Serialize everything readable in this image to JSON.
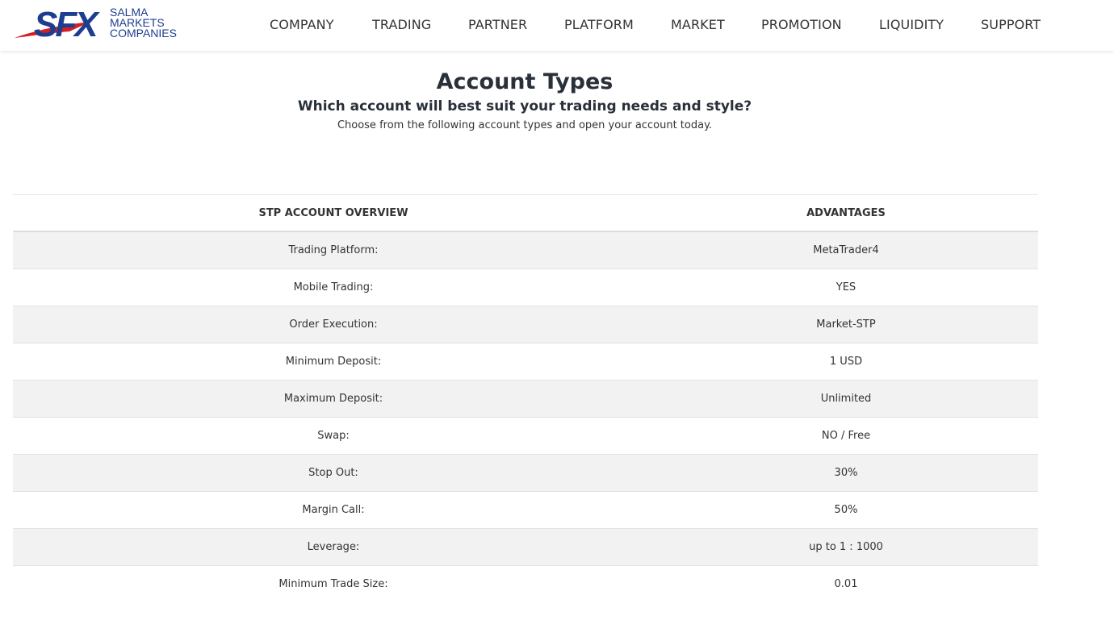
{
  "brand": {
    "mark": "SFX",
    "name_lines": [
      "SALMA",
      "MARKETS",
      "COMPANIES"
    ],
    "colors": {
      "blue": "#1d3d8f",
      "red": "#d21f26"
    }
  },
  "nav": {
    "items": [
      "COMPANY",
      "TRADING",
      "PARTNER",
      "PLATFORM",
      "MARKET",
      "PROMOTION",
      "LIQUIDITY",
      "SUPPORT"
    ]
  },
  "hero": {
    "title": "Account Types",
    "subtitle": "Which account will best suit your trading needs and style?",
    "lead": "Choose from the following account types and open your account today."
  },
  "table": {
    "headers": [
      "STP ACCOUNT OVERVIEW",
      "ADVANTAGES"
    ],
    "rows": [
      [
        "Trading Platform:",
        "MetaTrader4"
      ],
      [
        "Mobile Trading:",
        "YES"
      ],
      [
        "Order Execution:",
        "Market-STP"
      ],
      [
        "Minimum Deposit:",
        "1 USD"
      ],
      [
        "Maximum Deposit:",
        "Unlimited"
      ],
      [
        "Swap:",
        "NO / Free"
      ],
      [
        "Stop Out:",
        "30%"
      ],
      [
        "Margin Call:",
        "50%"
      ],
      [
        "Leverage:",
        "up to 1 : 1000"
      ],
      [
        "Minimum Trade Size:",
        "0.01"
      ]
    ]
  }
}
